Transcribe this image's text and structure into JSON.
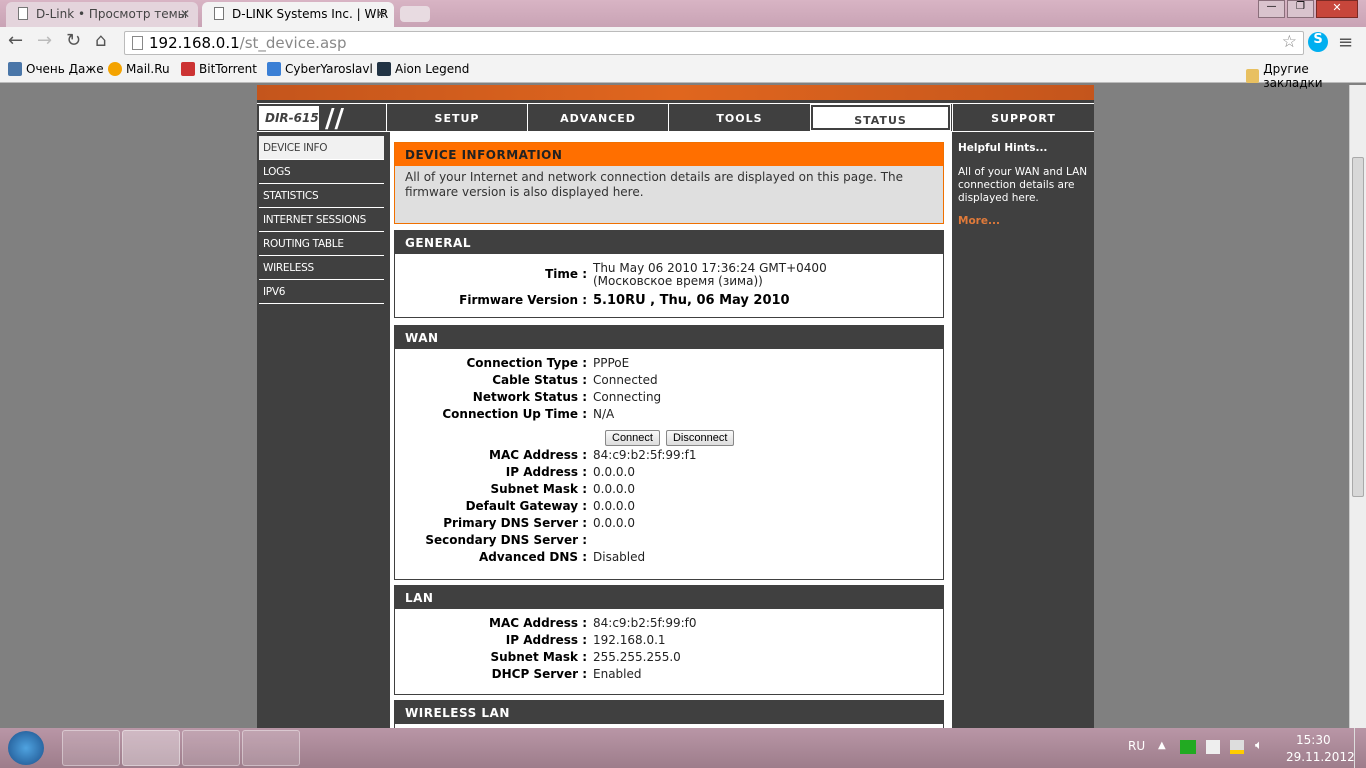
{
  "browser": {
    "tabs": [
      {
        "title": "D-Link • Просмотр темы"
      },
      {
        "title": "D-LINK Systems Inc. | WIR"
      }
    ],
    "url_host": "192.168.0.1",
    "url_path": "/st_device.asp",
    "bookmarks": [
      "Очень Даже",
      "Mail.Ru",
      "BitTorrent",
      "CyberYaroslavl",
      "Aion Legend"
    ],
    "other_bookmarks": "Другие закладки"
  },
  "router": {
    "model": "DIR-615",
    "nav": [
      "SETUP",
      "ADVANCED",
      "TOOLS",
      "STATUS",
      "SUPPORT"
    ],
    "sidebar": [
      "DEVICE INFO",
      "LOGS",
      "STATISTICS",
      "INTERNET SESSIONS",
      "ROUTING TABLE",
      "WIRELESS",
      "IPV6"
    ],
    "device_info": {
      "title": "DEVICE INFORMATION",
      "desc": "All of your Internet and network connection details are displayed on this page. The firmware version is also displayed here."
    },
    "general": {
      "title": "GENERAL",
      "time_label": "Time :",
      "time": "Thu May 06 2010 17:36:24 GMT+0400 (Московское время (зима))",
      "fw_label": "Firmware Version :",
      "fw": "5.10RU , Thu, 06 May 2010"
    },
    "wan": {
      "title": "WAN",
      "rows1": [
        [
          "Connection Type :",
          "PPPoE"
        ],
        [
          "Cable Status :",
          "Connected"
        ],
        [
          "Network Status :",
          "Connecting"
        ],
        [
          "Connection Up Time :",
          "N/A"
        ]
      ],
      "connect": "Connect",
      "disconnect": "Disconnect",
      "rows2": [
        [
          "MAC Address :",
          "84:c9:b2:5f:99:f1"
        ],
        [
          "IP Address :",
          "0.0.0.0"
        ],
        [
          "Subnet Mask :",
          "0.0.0.0"
        ],
        [
          "Default Gateway :",
          "0.0.0.0"
        ],
        [
          "Primary DNS Server :",
          "0.0.0.0"
        ],
        [
          "Secondary DNS Server :",
          ""
        ],
        [
          "Advanced DNS :",
          "Disabled"
        ]
      ]
    },
    "lan": {
      "title": "LAN",
      "rows": [
        [
          "MAC Address :",
          "84:c9:b2:5f:99:f0"
        ],
        [
          "IP Address :",
          "192.168.0.1"
        ],
        [
          "Subnet Mask :",
          "255.255.255.0"
        ],
        [
          "DHCP Server :",
          "Enabled"
        ]
      ]
    },
    "wlan": {
      "title": "WIRELESS LAN"
    },
    "hints": {
      "title": "Helpful Hints...",
      "text": "All of your WAN and LAN connection details are displayed here.",
      "more": "More..."
    }
  },
  "taskbar": {
    "lang": "RU",
    "time": "15:30",
    "date": "29.11.2012"
  }
}
